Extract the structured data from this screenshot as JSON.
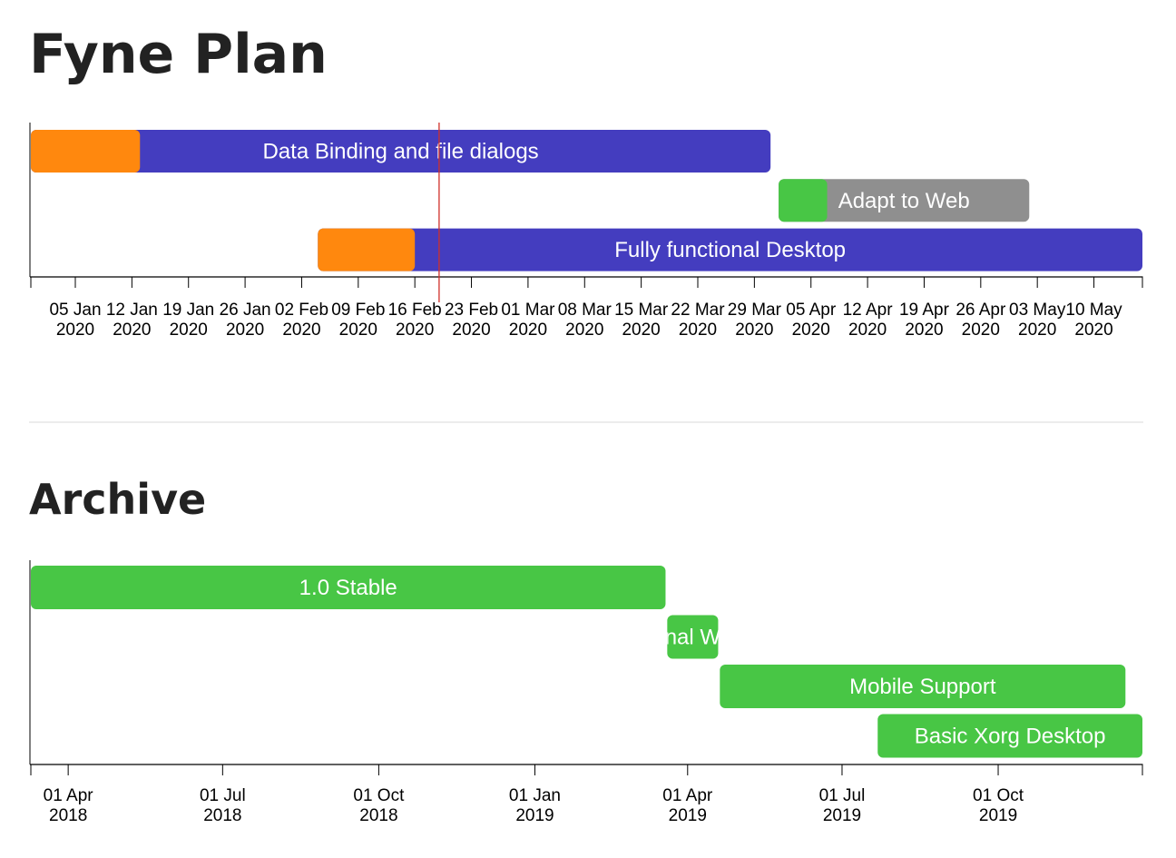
{
  "page": {
    "title": "Fyne Plan",
    "archive_title": "Archive"
  },
  "colors": {
    "in_progress": "#443dbf",
    "done": "#ff880e",
    "complete": "#48c645",
    "planned": "#8f8f8f",
    "today_line": "#d0302a",
    "axis": "#000000",
    "divider": "#e6e6e6"
  },
  "chart_data": [
    {
      "type": "gantt",
      "title": "Fyne Plan",
      "domain": [
        "2019-12-30T12:00",
        "2020-05-16T00:00"
      ],
      "today": "2020-02-19",
      "ticks": [
        {
          "date": "2020-01-05",
          "l1": "05 Jan",
          "l2": "2020"
        },
        {
          "date": "2020-01-12",
          "l1": "12 Jan",
          "l2": "2020"
        },
        {
          "date": "2020-01-19",
          "l1": "19 Jan",
          "l2": "2020"
        },
        {
          "date": "2020-01-26",
          "l1": "26 Jan",
          "l2": "2020"
        },
        {
          "date": "2020-02-02",
          "l1": "02 Feb",
          "l2": "2020"
        },
        {
          "date": "2020-02-09",
          "l1": "09 Feb",
          "l2": "2020"
        },
        {
          "date": "2020-02-16",
          "l1": "16 Feb",
          "l2": "2020"
        },
        {
          "date": "2020-02-23",
          "l1": "23 Feb",
          "l2": "2020"
        },
        {
          "date": "2020-03-01",
          "l1": "01 Mar",
          "l2": "2020"
        },
        {
          "date": "2020-03-08",
          "l1": "08 Mar",
          "l2": "2020"
        },
        {
          "date": "2020-03-15",
          "l1": "15 Mar",
          "l2": "2020"
        },
        {
          "date": "2020-03-22",
          "l1": "22 Mar",
          "l2": "2020"
        },
        {
          "date": "2020-03-29",
          "l1": "29 Mar",
          "l2": "2020"
        },
        {
          "date": "2020-04-05",
          "l1": "05 Apr",
          "l2": "2020"
        },
        {
          "date": "2020-04-12",
          "l1": "12 Apr",
          "l2": "2020"
        },
        {
          "date": "2020-04-19",
          "l1": "19 Apr",
          "l2": "2020"
        },
        {
          "date": "2020-04-26",
          "l1": "26 Apr",
          "l2": "2020"
        },
        {
          "date": "2020-05-03",
          "l1": "03 May",
          "l2": "2020"
        },
        {
          "date": "2020-05-10",
          "l1": "10 May",
          "l2": "2020"
        }
      ],
      "tasks": [
        {
          "label": "Data Binding and file dialogs",
          "start": "2019-12-30T12:00",
          "progress_end": "2020-01-13",
          "end": "2020-03-31",
          "color": "#443dbf",
          "progress_color": "#ff880e"
        },
        {
          "label": "Adapt to Web",
          "start": "2020-04-01",
          "progress_end": "2020-04-07",
          "end": "2020-05-02",
          "color": "#8f8f8f",
          "progress_color": "#48c645"
        },
        {
          "label": "Fully functional Desktop",
          "start": "2020-02-04",
          "progress_end": "2020-02-16",
          "end": "2020-05-16",
          "color": "#443dbf",
          "progress_color": "#ff880e"
        }
      ]
    },
    {
      "type": "gantt",
      "title": "Archive",
      "domain": [
        "2018-03-10",
        "2019-12-25"
      ],
      "ticks": [
        {
          "date": "2018-04-01",
          "l1": "01 Apr",
          "l2": "2018"
        },
        {
          "date": "2018-07-01",
          "l1": "01 Jul",
          "l2": "2018"
        },
        {
          "date": "2018-10-01",
          "l1": "01 Oct",
          "l2": "2018"
        },
        {
          "date": "2019-01-01",
          "l1": "01 Jan",
          "l2": "2019"
        },
        {
          "date": "2019-04-01",
          "l1": "01 Apr",
          "l2": "2019"
        },
        {
          "date": "2019-07-01",
          "l1": "01 Jul",
          "l2": "2019"
        },
        {
          "date": "2019-10-01",
          "l1": "01 Oct",
          "l2": "2019"
        }
      ],
      "tasks": [
        {
          "label": "1.0 Stable",
          "start": "2018-03-10",
          "end": "2019-03-19",
          "color": "#48c645"
        },
        {
          "label": "nal W",
          "start": "2019-03-20",
          "end": "2019-04-19",
          "color": "#48c645"
        },
        {
          "label": "Mobile Support",
          "start": "2019-04-20",
          "end": "2019-12-15",
          "color": "#48c645"
        },
        {
          "label": "Basic Xorg Desktop",
          "start": "2019-07-22",
          "end": "2019-12-25",
          "color": "#48c645"
        }
      ]
    }
  ]
}
